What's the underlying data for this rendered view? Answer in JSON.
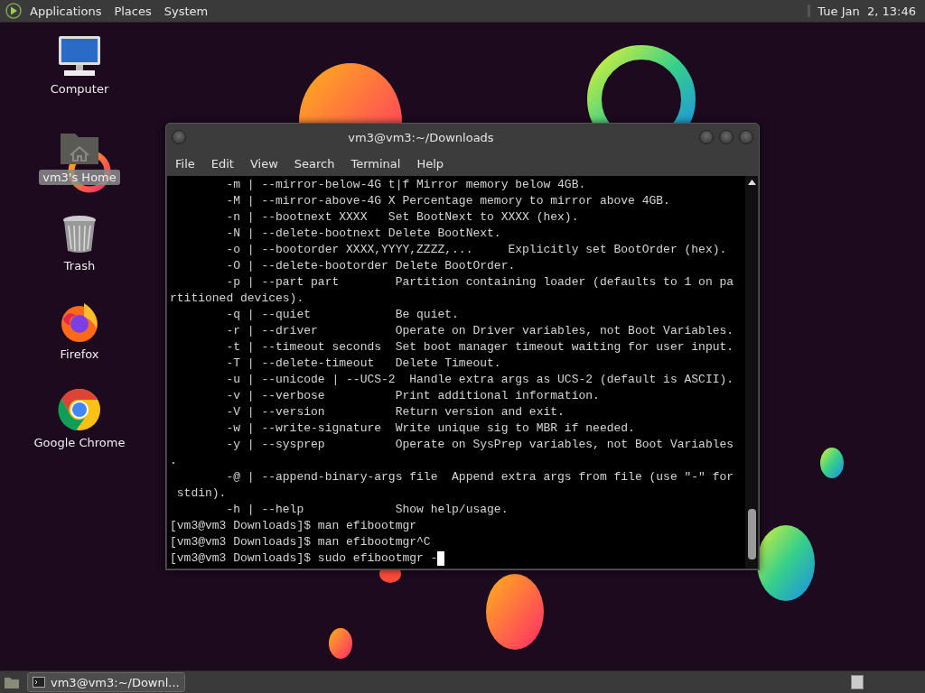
{
  "top_panel": {
    "menus": [
      "Applications",
      "Places",
      "System"
    ],
    "clock": "Tue Jan  2, 13:46"
  },
  "desktop_icons": [
    {
      "kind": "computer",
      "label": "Computer",
      "selected": false
    },
    {
      "kind": "home",
      "label": "vm3's Home",
      "selected": true
    },
    {
      "kind": "trash",
      "label": "Trash",
      "selected": false
    },
    {
      "kind": "firefox",
      "label": "Firefox",
      "selected": false
    },
    {
      "kind": "chrome",
      "label": "Google Chrome",
      "selected": false
    }
  ],
  "terminal": {
    "title": "vm3@vm3:~/Downloads",
    "menu": [
      "File",
      "Edit",
      "View",
      "Search",
      "Terminal",
      "Help"
    ],
    "lines": [
      "        -m | --mirror-below-4G t|f Mirror memory below 4GB.",
      "        -M | --mirror-above-4G X Percentage memory to mirror above 4GB.",
      "        -n | --bootnext XXXX   Set BootNext to XXXX (hex).",
      "        -N | --delete-bootnext Delete BootNext.",
      "        -o | --bootorder XXXX,YYYY,ZZZZ,...     Explicitly set BootOrder (hex).",
      "        -O | --delete-bootorder Delete BootOrder.",
      "        -p | --part part        Partition containing loader (defaults to 1 on pa",
      "rtitioned devices).",
      "        -q | --quiet            Be quiet.",
      "        -r | --driver           Operate on Driver variables, not Boot Variables.",
      "        -t | --timeout seconds  Set boot manager timeout waiting for user input.",
      "        -T | --delete-timeout   Delete Timeout.",
      "        -u | --unicode | --UCS-2  Handle extra args as UCS-2 (default is ASCII).",
      "        -v | --verbose          Print additional information.",
      "        -V | --version          Return version and exit.",
      "        -w | --write-signature  Write unique sig to MBR if needed.",
      "        -y | --sysprep          Operate on SysPrep variables, not Boot Variables",
      ".",
      "        -@ | --append-binary-args file  Append extra args from file (use \"-\" for",
      " stdin).",
      "        -h | --help             Show help/usage.",
      "[vm3@vm3 Downloads]$ man efibootmgr",
      "[vm3@vm3 Downloads]$ man efibootmgr^C",
      "[vm3@vm3 Downloads]$ sudo efibootmgr -"
    ]
  },
  "bottom_panel": {
    "task": "vm3@vm3:~/Downl..."
  }
}
